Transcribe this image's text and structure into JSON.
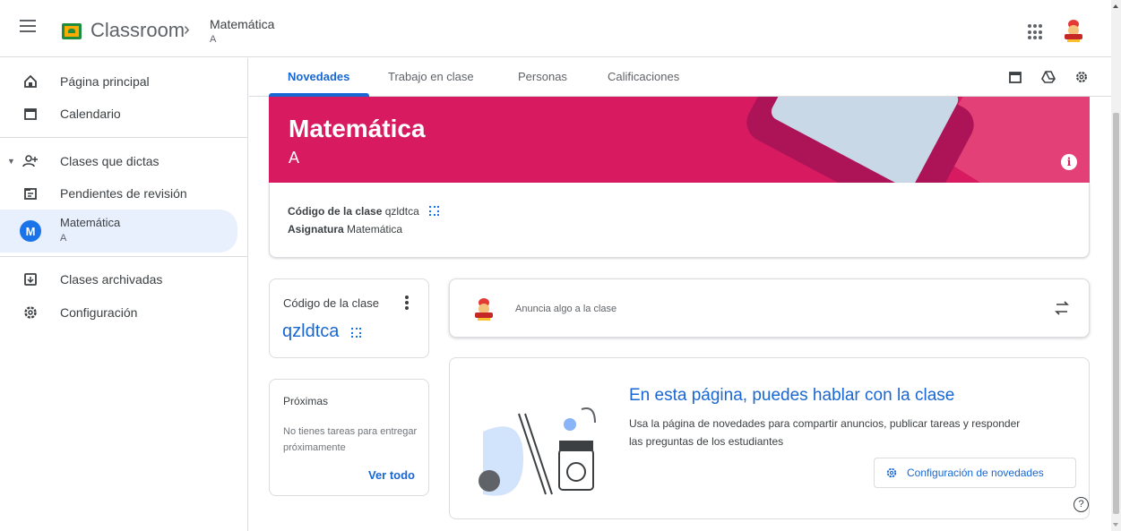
{
  "header": {
    "app_title": "Classroom",
    "class_title": "Matemática",
    "class_section": "A"
  },
  "sidebar": {
    "items": [
      {
        "label": "Página principal",
        "icon": "home-icon"
      },
      {
        "label": "Calendario",
        "icon": "calendar-icon"
      },
      {
        "label": "Clases que dictas",
        "icon": "people-icon"
      },
      {
        "label": "Pendientes de revisión",
        "icon": "todo-icon"
      },
      {
        "label": "Matemática",
        "sub": "A",
        "avatar_letter": "M",
        "active": true
      },
      {
        "label": "Clases archivadas",
        "icon": "archive-icon"
      },
      {
        "label": "Configuración",
        "icon": "settings-icon"
      }
    ]
  },
  "tabs": [
    {
      "label": "Novedades",
      "active": true
    },
    {
      "label": "Trabajo en clase"
    },
    {
      "label": "Personas"
    },
    {
      "label": "Calificaciones"
    }
  ],
  "banner": {
    "title": "Matemática",
    "section": "A",
    "color": "#d81b60"
  },
  "class_info": {
    "code_label": "Código de la clase",
    "code_value": "qzldtca",
    "subject_label": "Asignatura",
    "subject_value": "Matemática"
  },
  "code_card": {
    "title": "Código de la clase",
    "code": "qzldtca"
  },
  "upcoming": {
    "title": "Próximas",
    "text": "No tienes tareas para entregar próximamente",
    "link": "Ver todo"
  },
  "announce": {
    "placeholder": "Anuncia algo a la clase"
  },
  "empty_state": {
    "title": "En esta página, puedes hablar con la clase",
    "description": "Usa la página de novedades para compartir anuncios, publicar tareas y responder las preguntas de los estudiantes",
    "button": "Configuración de novedades"
  },
  "colors": {
    "accent": "#1967d2",
    "banner": "#d81b60"
  }
}
